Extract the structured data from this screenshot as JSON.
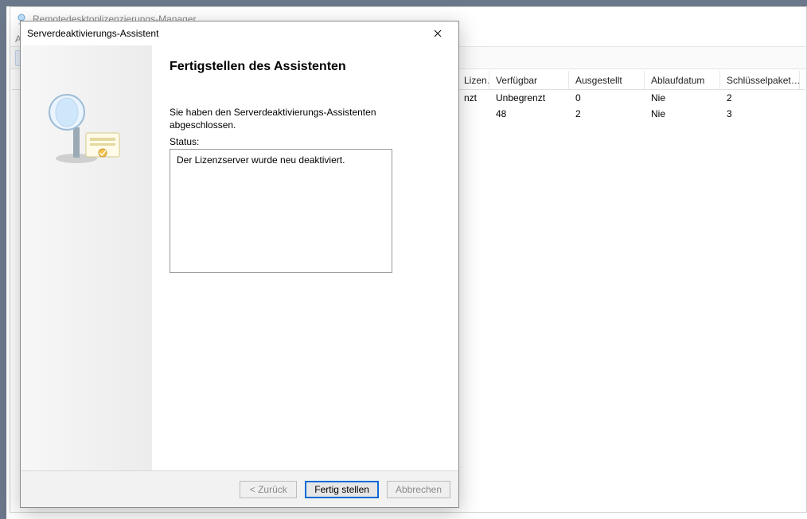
{
  "main_window": {
    "title": "Remotedesktoplizenzierungs-Manager",
    "menu_label": "A",
    "columns": {
      "col1": "",
      "lizen": "Lizen…",
      "verfuegbar": "Verfügbar",
      "ausgestellt": "Ausgestellt",
      "ablaufdatum": "Ablaufdatum",
      "schluesselpaket": "Schlüsselpaket…"
    },
    "rows": [
      {
        "col1": "",
        "lizen": "nzt",
        "verfuegbar": "Unbegrenzt",
        "ausgestellt": "0",
        "ablaufdatum": "Nie",
        "schluesselpaket": "2"
      },
      {
        "col1": "",
        "lizen": "",
        "verfuegbar": "48",
        "ausgestellt": "2",
        "ablaufdatum": "Nie",
        "schluesselpaket": "3"
      }
    ]
  },
  "wizard": {
    "title": "Serverdeaktivierungs-Assistent",
    "heading": "Fertigstellen des Assistenten",
    "completion_text": "Sie haben den Serverdeaktivierungs-Assistenten abgeschlossen.",
    "status_label": "Status:",
    "status_text": "Der Lizenzserver wurde neu deaktiviert.",
    "buttons": {
      "back": "< Zurück",
      "finish": "Fertig stellen",
      "cancel": "Abbrechen"
    }
  }
}
